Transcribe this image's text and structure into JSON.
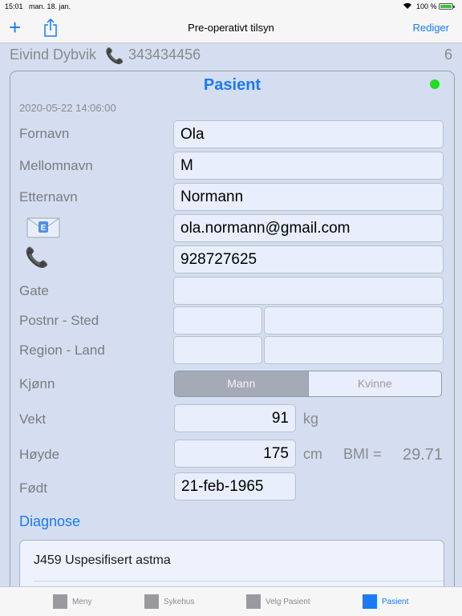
{
  "status_bar": {
    "time": "15:01",
    "date": "man. 18. jan.",
    "battery_percent": "100 %"
  },
  "nav": {
    "add_icon": "plus-icon",
    "share_icon": "share-icon",
    "title": "Pre-operativt tilsyn",
    "edit_label": "Rediger"
  },
  "patient_line": {
    "name": "Eivind Dybvik",
    "phone_icon": "phone-icon",
    "phone": "343434456",
    "count": "6"
  },
  "card": {
    "title": "Pasient",
    "status_color": "#22dd22",
    "timestamp": "2020-05-22 14:06:00",
    "labels": {
      "first_name": "Fornavn",
      "middle_name": "Mellomnavn",
      "last_name": "Etternavn",
      "street": "Gate",
      "postal": "Postnr - Sted",
      "region": "Region - Land",
      "gender": "Kjønn",
      "weight": "Vekt",
      "height": "Høyde",
      "born": "Født"
    },
    "values": {
      "first_name": "Ola",
      "middle_name": "M",
      "last_name": "Normann",
      "email": "ola.normann@gmail.com",
      "phone": "928727625",
      "street": "",
      "postal_code": "",
      "city": "",
      "region": "",
      "country": "",
      "weight": "91",
      "height": "175",
      "born": "21-feb-1965"
    },
    "email_icon": "email-icon",
    "phone_icon": "phone-icon",
    "gender_options": [
      "Mann",
      "Kvinne"
    ],
    "gender_selected": "Mann",
    "weight_unit": "kg",
    "height_unit": "cm",
    "bmi_label": "BMI =",
    "bmi_value": "29.71",
    "diagnose_label": "Diagnose",
    "diagnoses": [
      "J459 Uspesifisert astma"
    ]
  },
  "tabs": [
    {
      "label": "Meny",
      "active": false
    },
    {
      "label": "Sykehus",
      "active": false
    },
    {
      "label": "Velg Pasient",
      "active": false
    },
    {
      "label": "Pasient",
      "active": true
    }
  ],
  "colors": {
    "accent": "#1a7af8",
    "background": "#d4def0"
  }
}
